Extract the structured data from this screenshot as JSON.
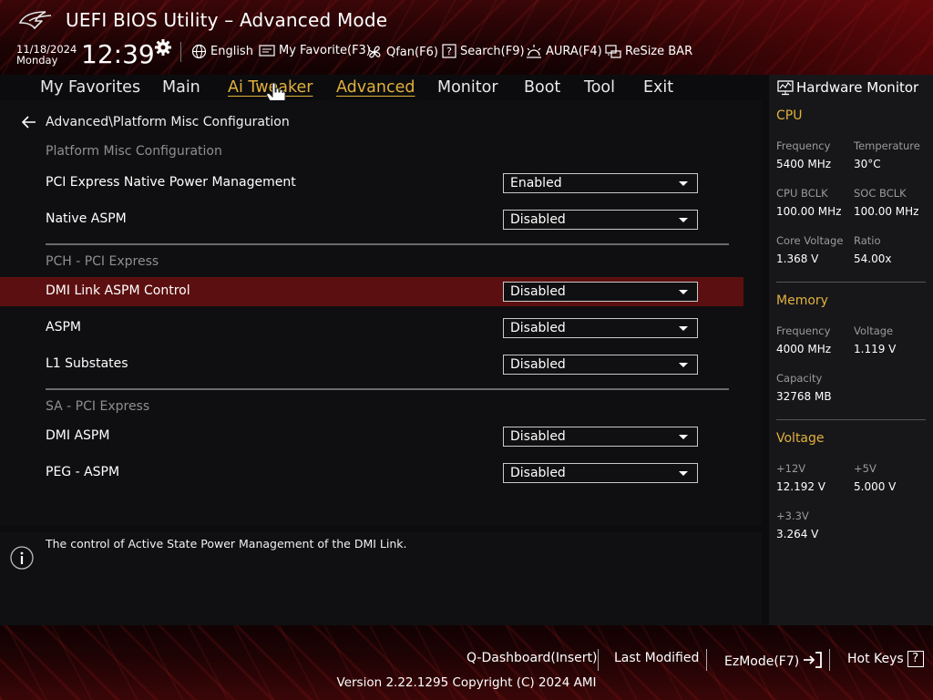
{
  "header": {
    "title": "UEFI BIOS Utility – Advanced Mode",
    "date": "11/18/2024",
    "day": "Monday",
    "time": "12:39",
    "tools": [
      {
        "label": "English",
        "icon": "globe-icon"
      },
      {
        "label": "My Favorite(F3)",
        "icon": "favorite-icon"
      },
      {
        "label": "Qfan(F6)",
        "icon": "fan-icon"
      },
      {
        "label": "Search(F9)",
        "icon": "search-help-icon"
      },
      {
        "label": "AURA(F4)",
        "icon": "aura-icon"
      },
      {
        "label": "ReSize BAR",
        "icon": "resize-bar-icon"
      }
    ]
  },
  "nav": {
    "tabs": [
      "My Favorites",
      "Main",
      "Ai Tweaker",
      "Advanced",
      "Monitor",
      "Boot",
      "Tool",
      "Exit"
    ],
    "active": "Advanced"
  },
  "page": {
    "breadcrumb": "Advanced\\Platform Misc Configuration",
    "sections": [
      {
        "title": "Platform Misc Configuration"
      },
      {
        "title": "PCH - PCI Express"
      },
      {
        "title": "SA - PCI Express"
      }
    ],
    "settings": [
      {
        "label": "PCI Express Native Power Management",
        "value": "Enabled"
      },
      {
        "label": "Native ASPM",
        "value": "Disabled"
      },
      {
        "label": "DMI Link ASPM Control",
        "value": "Disabled"
      },
      {
        "label": "ASPM",
        "value": "Disabled"
      },
      {
        "label": "L1 Substates",
        "value": "Disabled"
      },
      {
        "label": "DMI ASPM",
        "value": "Disabled"
      },
      {
        "label": "PEG - ASPM",
        "value": "Disabled"
      }
    ],
    "selected_setting": "DMI Link ASPM Control"
  },
  "help": {
    "text": "The control of Active State Power Management of the DMI Link."
  },
  "hw": {
    "title": "Hardware Monitor",
    "cpu": {
      "title": "CPU",
      "frequency_label": "Frequency",
      "frequency": "5400 MHz",
      "temperature_label": "Temperature",
      "temperature": "30°C",
      "bclk_label": "CPU BCLK",
      "bclk": "100.00 MHz",
      "soc_bclk_label": "SOC BCLK",
      "soc_bclk": "100.00 MHz",
      "core_voltage_label": "Core Voltage",
      "core_voltage": "1.368 V",
      "ratio_label": "Ratio",
      "ratio": "54.00x"
    },
    "memory": {
      "title": "Memory",
      "frequency_label": "Frequency",
      "frequency": "4000 MHz",
      "voltage_label": "Voltage",
      "voltage": "1.119 V",
      "capacity_label": "Capacity",
      "capacity": "32768 MB"
    },
    "voltage": {
      "title": "Voltage",
      "v12_label": "+12V",
      "v12": "12.192 V",
      "v5_label": "+5V",
      "v5": "5.000 V",
      "v33_label": "+3.3V",
      "v33": "3.264 V"
    }
  },
  "footer": {
    "qdashboard": "Q-Dashboard(Insert)",
    "last_modified": "Last Modified",
    "ezmode": "EzMode(F7)",
    "hotkeys": "Hot Keys",
    "hotkeys_glyph": "?",
    "version": "Version 2.22.1295 Copyright (C) 2024 AMI"
  },
  "colors": {
    "accent": "#e2b13c",
    "highlight_row": "#5c0f10",
    "header_red": "#3a0608"
  }
}
